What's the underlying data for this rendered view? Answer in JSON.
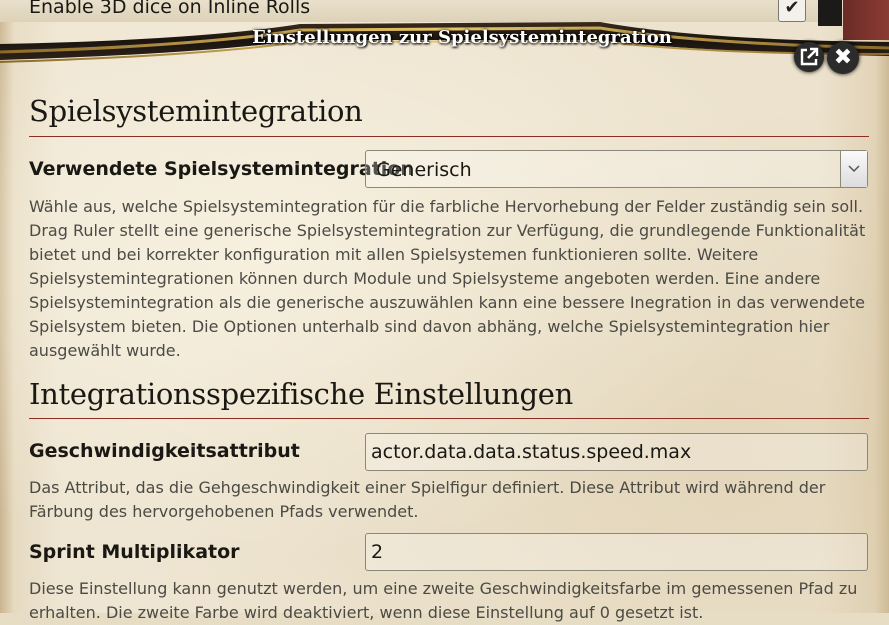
{
  "background_window": {
    "row_label": "Enable 3D dice on Inline Rolls",
    "checkbox_checked": true
  },
  "header": {
    "title": "Einstellungen zur Spielsystemintegration",
    "popout_icon": "external-link-icon",
    "close_icon": "close-icon"
  },
  "section1": {
    "title": "Spielsystemintegration",
    "field_label": "Verwendete Spielsystemintegration",
    "select_value": "Generisch",
    "hint": "Wähle aus, welche Spielsystemintegration für die farbliche Hervorhebung der Felder zuständig sein soll. Drag Ruler stellt eine generische Spielsystemintegration zur Verfügung, die grundlegende Funktionalität bietet und bei korrekter konfiguration mit allen Spielsystemen funktionieren sollte. Weitere Spielsystemintegrationen können durch Module und Spielsysteme angeboten werden. Eine andere Spielsystemintegration als die generische auszuwählen kann eine bessere Inegration in das verwendete Spielsystem bieten. Die Optionen unterhalb sind davon abhäng, welche Spielsystemintegration hier ausgewählt wurde."
  },
  "section2": {
    "title": "Integrationsspezifische Einstellungen",
    "speed_label": "Geschwindigkeitsattribut",
    "speed_value": "actor.data.data.status.speed.max",
    "speed_hint": "Das Attribut, das die Gehgeschwindigkeit einer Spielfigur definiert. Diese Attribut wird während der Färbung des hervorgehobenen Pfads verwendet.",
    "sprint_label": "Sprint Multiplikator",
    "sprint_value": "2",
    "sprint_hint": "Diese Einstellung kann genutzt werden, um eine zweite Geschwindigkeitsfarbe im gemessenen Pfad zu erhalten. Die zweite Farbe wird deaktiviert, wenn diese Einstellung auf 0 gesetzt ist."
  }
}
